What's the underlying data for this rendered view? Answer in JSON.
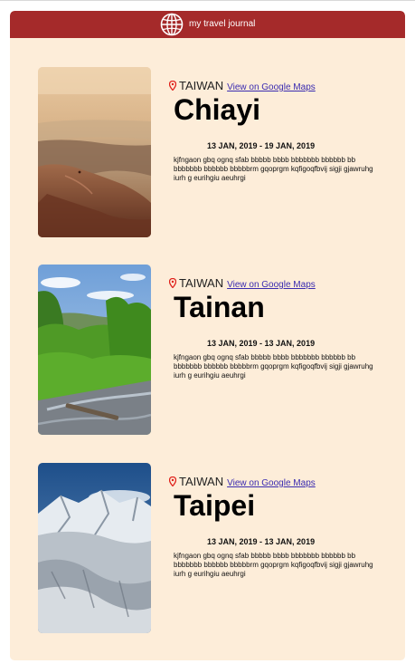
{
  "header": {
    "brand": "my travel journal",
    "logo_icon": "globe-icon",
    "color": "#a52a2a"
  },
  "page": {
    "background": "#fdedd9"
  },
  "entries": [
    {
      "country": "TAIWAN",
      "maps_link": "View on Google Maps",
      "city": "Chiayi",
      "dates": "13 JAN, 2019 - 19 JAN, 2019",
      "description": "kjfngaon gbq ognq sfab bbbbb bbbb bbbbbbb bbbbbb bb bbbbbbb bbbbbb bbbbbrm gqoprgm kqfigoqfbvij sigji gjawruhg iurh g eurihgiu aeuhrgi",
      "image": "canyon-cliff-photo"
    },
    {
      "country": "TAIWAN",
      "maps_link": "View on Google Maps",
      "city": "Tainan",
      "dates": "13 JAN, 2019 - 13 JAN, 2019",
      "description": "kjfngaon gbq ognq sfab bbbbb bbbb bbbbbbb bbbbbb bb bbbbbbb bbbbbb bbbbbrm gqoprgm kqfigoqfbvij sigji gjawruhg iurh g eurihgiu aeuhrgi",
      "image": "forest-river-photo"
    },
    {
      "country": "TAIWAN",
      "maps_link": "View on Google Maps",
      "city": "Taipei",
      "dates": "13 JAN, 2019 - 13 JAN, 2019",
      "description": "kjfngaon gbq ognq sfab bbbbb bbbb bbbbbbb bbbbbb bb bbbbbbb bbbbbb bbbbbrm gqoprgm kqfigoqfbvij sigji gjawruhg iurh g eurihgiu aeuhrgi",
      "image": "snowy-mountain-photo"
    }
  ]
}
